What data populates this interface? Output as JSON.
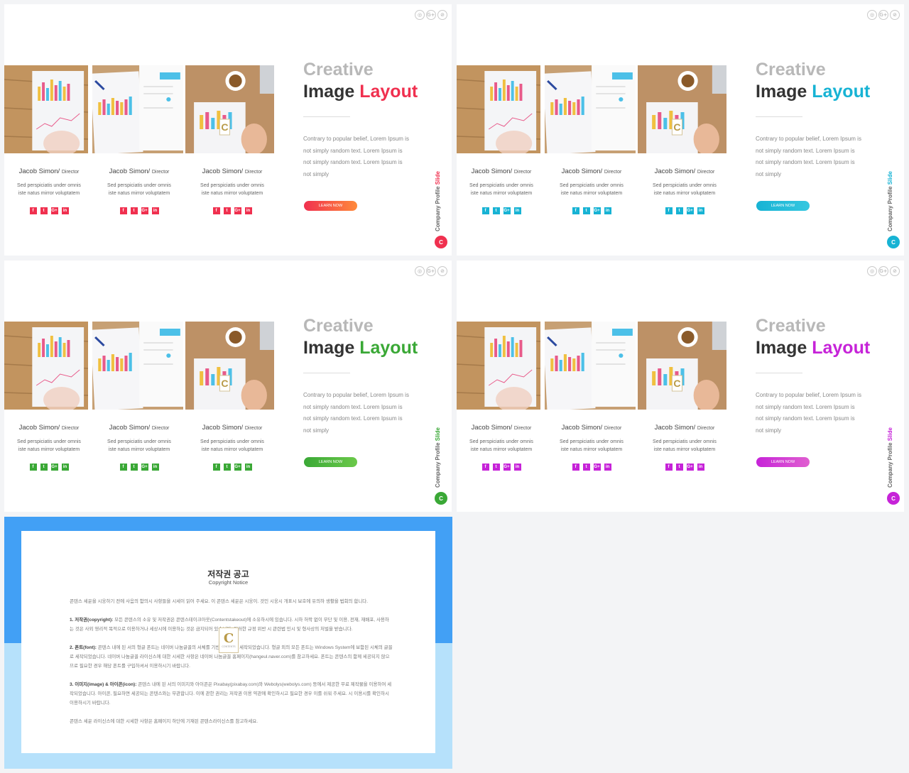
{
  "slides": [
    {
      "accent": "#f0304f",
      "accent2": "#ff8a3a",
      "layout_label": "Layout"
    },
    {
      "accent": "#17b3d4",
      "accent2": "#35c7e0",
      "layout_label": "Layout"
    },
    {
      "accent": "#3aa836",
      "accent2": "#6bc94a",
      "layout_label": "Layout"
    },
    {
      "accent": "#c623d8",
      "accent2": "#e05fd0",
      "layout_label": "Layout"
    }
  ],
  "common": {
    "title_line1": "Creative",
    "title_line2": "Image",
    "paragraph": "Contrary to popular belief, Lorem Ipsum is not simply random text. Lorem Ipsum is not simply random text. Lorem Ipsum is not simply",
    "button": "LEARN NOW",
    "side_text": "Company Profile",
    "side_accent": "Slide",
    "logo": "C",
    "top_icons": [
      "whatsapp-icon",
      "google-plus-icon",
      "compass-icon"
    ],
    "top_icon_glyphs": [
      "◎",
      "G+",
      "⊘"
    ],
    "people": [
      {
        "name": "Jacob Simon/",
        "role": "Director",
        "desc1": "Sed perspiciatis under omnis",
        "desc2": "iste natus mirror voluptatem"
      },
      {
        "name": "Jacob Simon/",
        "role": "Director",
        "desc1": "Sed perspiciatis under omnis",
        "desc2": "iste natus mirror voluptatem"
      },
      {
        "name": "Jacob Simon/",
        "role": "Director",
        "desc1": "Sed perspiciatis under omnis",
        "desc2": "iste natus mirror voluptatem"
      }
    ],
    "social": [
      "f",
      "t",
      "G+",
      "in"
    ],
    "social_icons": [
      "facebook-icon",
      "twitter-icon",
      "google-plus-icon",
      "linkedin-icon"
    ]
  },
  "copyright": {
    "title": "저작권 공고",
    "subtitle": "Copyright Notice",
    "intro": "콘텐스 세운을 시웅하기 전에 사음의 함의시 사항들을 시세이 읽어 주세요. 이 콘텐스 세운은 시웅이. 것인 시웅시 개표시 보호에 유의하 생활을 법회의 합니다.",
    "p1_head": "1. 저작권(copyright):",
    "p1": "모든 콘텐스의 소유 및 저작권은 콘텐스테이크아웃(Contentstakeout)에 소유하시에 있습니다. 시하 허락 없이 무단 및 이용, 전재, 재배포, 사용하는 것은 사외 영리적 목적으로 이용하거나 세상시에 이용하는 것은 금지되어 있습니다. 이러한 규정 위반 시 관련법 민시 및 형사상의 처벌을 받습니다.",
    "p2_head": "2. 폰트(font):",
    "p2": "콘텐스 내에 된 서의 형글 폰트는 네이버 나눔글꼴의 서체를 기반으로 하여 세작되었습니다. 형글 외의 모든 폰트는 Windows System에 보함된 시체의 글꼴로 세작되었습니다. 네이버 나눔글꼴 라이신스에 대한 시세한 사항은 네이버 나눔글꼴 홈페이지(hangeul.naver.com)를 참고하세요. 폰트는 콘텐스의 함께 세공되지 않으므로 필요한 경우 해당 폰트를 구입하셔서 이용하시기 바랍니다.",
    "p3_head": "3. 이미지(image) & 아이콘(icon):",
    "p3": "콘텐스 내에 된 서의 이미지와 아이콘은 Pixabay(pixabay.com)와 Webolys(webolys.com) 등에서 제공한 무료 제작물을 이용하여 세작되었습니다. 아이콘, 필요하면 세공되는 콘텐스와는 무관합니다. 이에 관한 권리는 저작권 이용 약관에 확인하시고 필요한 경우 이를 쉬워 주세요. 시 이용시를 확인하시 이용하시기 바랍니다.",
    "outro": "콘텐스 세운 라이신스에 대한 시세한 사항은 홈페이지 하단에 기재된 콘텐스라이신스를 참고하세요.",
    "badge_letter": "C",
    "badge_text": "CONTENTS"
  }
}
